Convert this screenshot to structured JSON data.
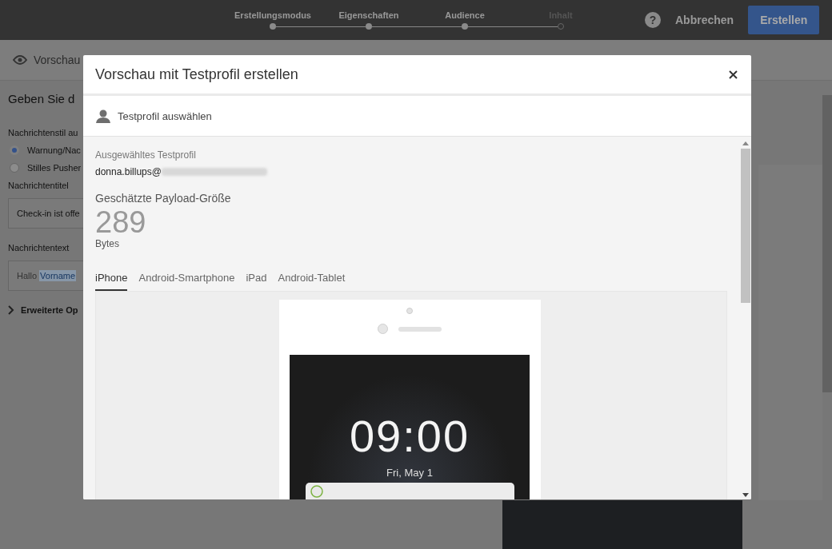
{
  "header": {
    "steps": [
      {
        "label": "Erstellungsmodus",
        "completed": true
      },
      {
        "label": "Eigenschaften",
        "completed": true
      },
      {
        "label": "Audience",
        "completed": true
      },
      {
        "label": "Inhalt",
        "completed": false
      }
    ],
    "help": "?",
    "cancel": "Abbrechen",
    "create": "Erstellen"
  },
  "page": {
    "preview_link": "Vorschau",
    "heading": "Geben Sie d",
    "style_label": "Nachrichtenstil au",
    "styles": [
      {
        "label": "Warnung/Nac",
        "selected": true
      },
      {
        "label": "Stilles Pusher",
        "selected": false
      }
    ],
    "title_label": "Nachrichtentitel",
    "title_value": "Check-in ist offe",
    "text_label": "Nachrichtentext",
    "text_value": [
      {
        "text": "Hallo",
        "kind": "plain"
      },
      {
        "text": "Vorname",
        "kind": "field"
      }
    ],
    "advanced": {
      "label": "Erweiterte Op",
      "expanded": false
    }
  },
  "dialog": {
    "title": "Vorschau mit Testprofil erstellen",
    "select_profile": "Testprofil auswählen",
    "profile_label": "Ausgewähltes Testprofil",
    "profile_value": "donna.billups@",
    "payload_label": "Geschätzte Payload-Größe",
    "payload_size": "289",
    "payload_unit": "Bytes",
    "tabs": [
      {
        "label": "iPhone",
        "selected": true
      },
      {
        "label": "Android-Smartphone",
        "selected": false
      },
      {
        "label": "iPad",
        "selected": false
      },
      {
        "label": "Android-Tablet",
        "selected": false
      }
    ],
    "preview": {
      "time": "09:00",
      "date": "Fri, May 1"
    }
  }
}
